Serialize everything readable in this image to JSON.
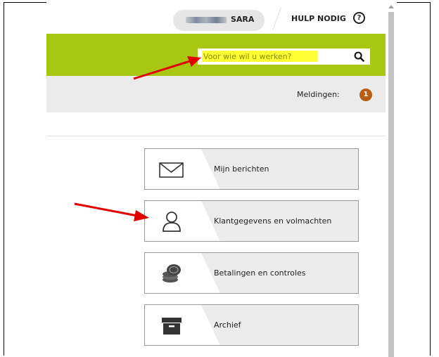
{
  "header": {
    "user_name": "SARA",
    "help_label": "HULP NODIG",
    "help_icon": "question-icon"
  },
  "search": {
    "placeholder": "Voor wie wil u werken?",
    "icon": "search-icon"
  },
  "notifications": {
    "label": "Meldingen:",
    "count": "1",
    "badge_color": "#b85d12"
  },
  "tiles": [
    {
      "label": "Mijn berichten",
      "icon": "envelope-icon"
    },
    {
      "label": "Klantgegevens en volmachten",
      "icon": "user-icon"
    },
    {
      "label": "Betalingen en controles",
      "icon": "coins-icon"
    },
    {
      "label": "Archief",
      "icon": "archive-icon"
    }
  ],
  "colors": {
    "accent_green": "#a7c713",
    "highlight_yellow": "#ffff33",
    "annotation_red": "#e00000"
  }
}
